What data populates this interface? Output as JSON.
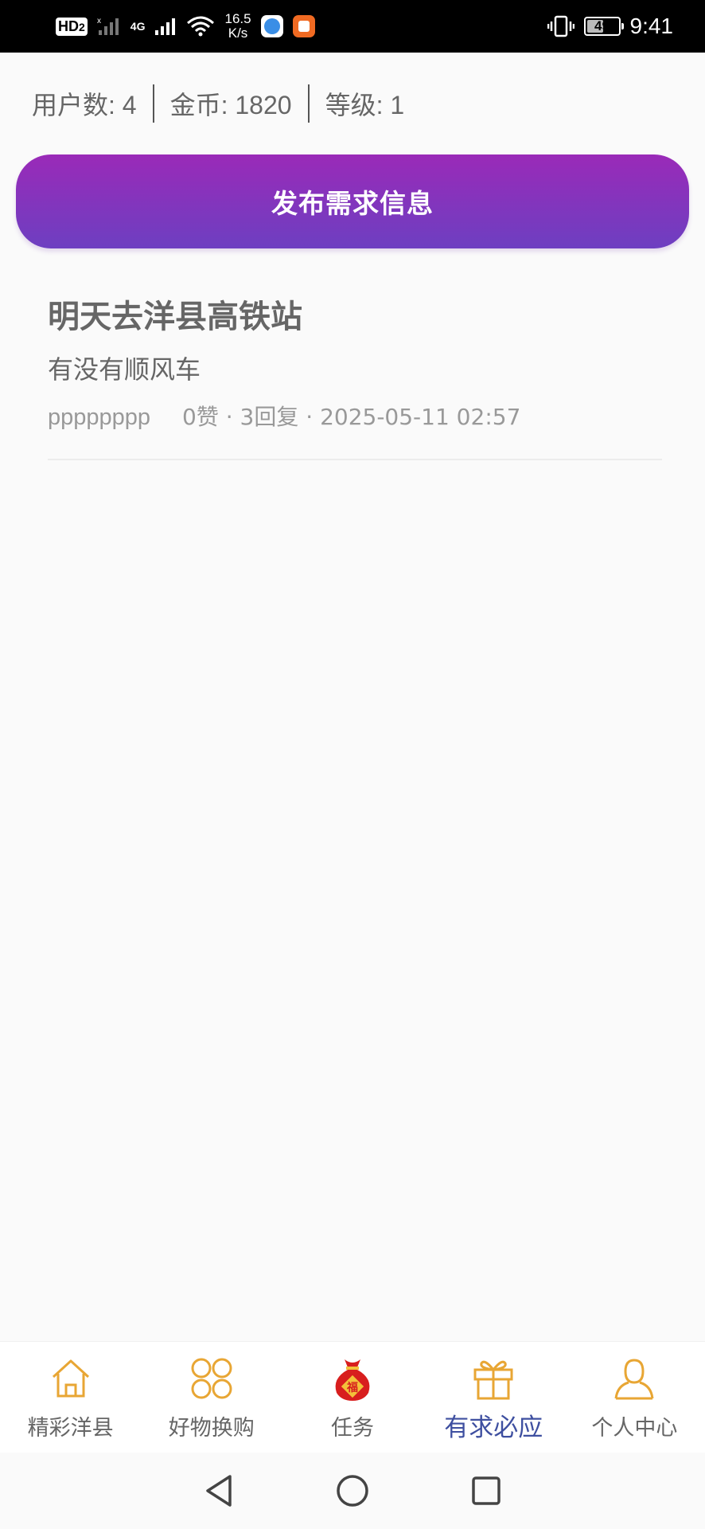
{
  "status_bar": {
    "hd": "HD",
    "hd_sub": "2",
    "network": "4G",
    "speed_value": "16.5",
    "speed_unit": "K/s",
    "battery": "49",
    "time": "9:41"
  },
  "stats": {
    "users": "用户数: 4",
    "coins": "金币: 1820",
    "level": "等级: 1"
  },
  "publish_button": "发布需求信息",
  "posts": [
    {
      "title": "明天去洋县高铁站",
      "body": "有没有顺风车",
      "author": "pppppppp",
      "meta": "0赞 · 3回复 · 2025-05-11 02:57"
    }
  ],
  "tabs": [
    {
      "label": "精彩洋县",
      "icon": "home-icon",
      "active": false
    },
    {
      "label": "好物换购",
      "icon": "grid-icon",
      "active": false
    },
    {
      "label": "任务",
      "icon": "lucky-bag-icon",
      "active": false
    },
    {
      "label": "有求必应",
      "icon": "gift-icon",
      "active": true
    },
    {
      "label": "个人中心",
      "icon": "user-icon",
      "active": false
    }
  ],
  "colors": {
    "accent_gradient_top": "#9a2ab8",
    "accent_gradient_bottom": "#6d3fc1",
    "tab_icon": "#e8a634",
    "tab_active_text": "#3e4fa0"
  }
}
